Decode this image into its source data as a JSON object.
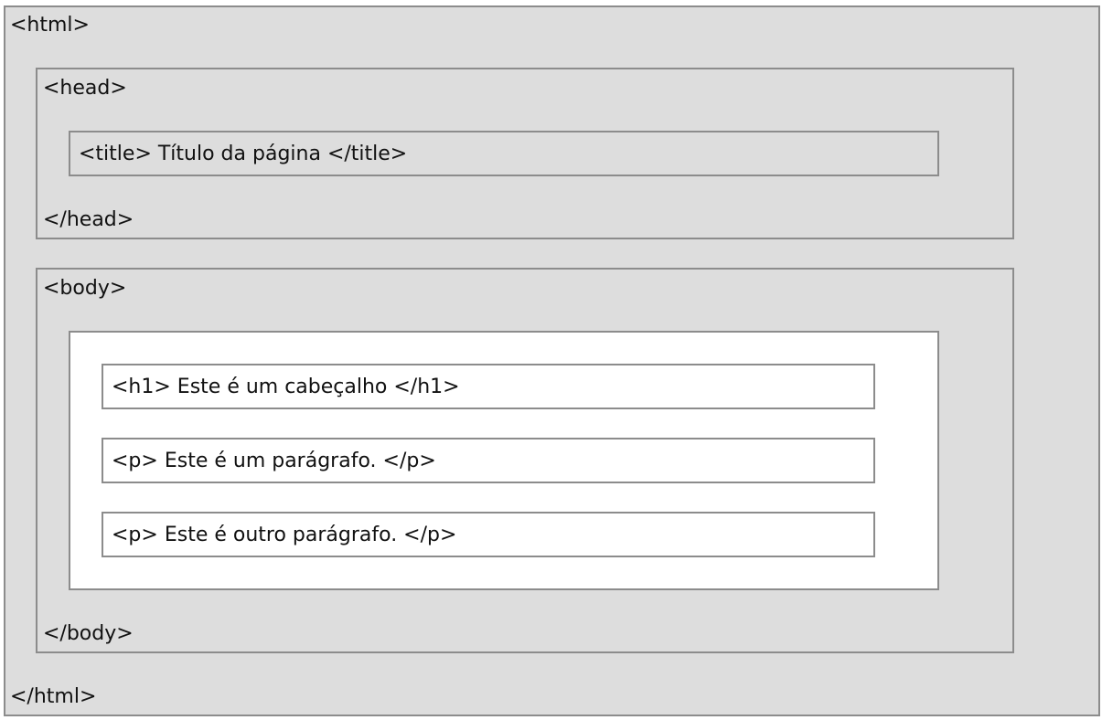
{
  "diagram": {
    "html_open": "<html>",
    "html_close": "</html>",
    "head_open": "<head>",
    "head_close": "</head>",
    "title_element": "<title> Título da página </title>",
    "body_open": "<body>",
    "body_close": "</body>",
    "h1_element": "<h1> Este é um cabeçalho </h1>",
    "p1_element": "<p> Este é um parágrafo. </p>",
    "p2_element": "<p> Este é outro parágrafo. </p>"
  },
  "colors": {
    "container_background": "#dddddd",
    "border": "#8c8c8c",
    "content_background": "#ffffff"
  }
}
